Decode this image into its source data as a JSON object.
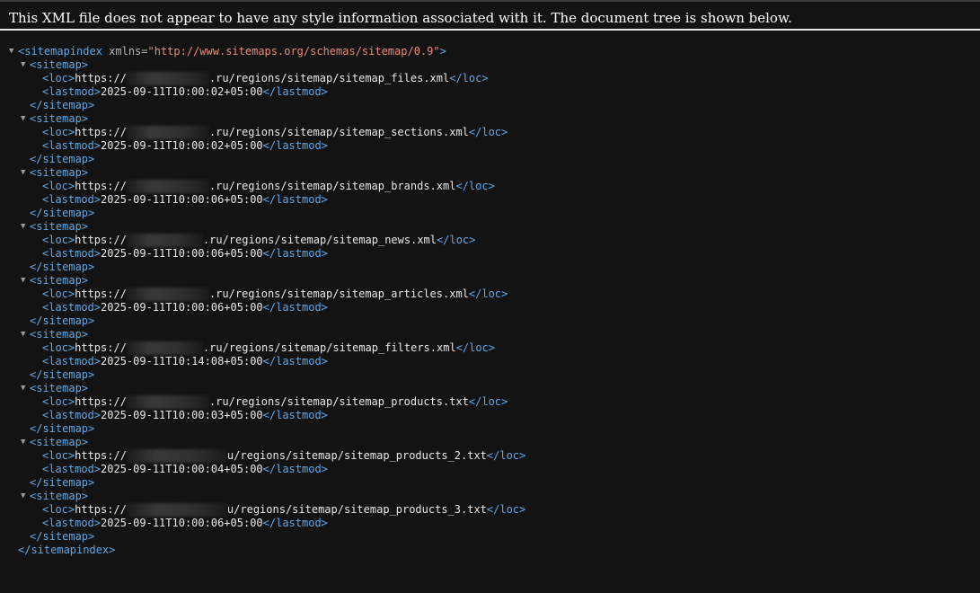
{
  "header": {
    "message": "This XML file does not appear to have any style information associated with it. The document tree is shown below."
  },
  "colors": {
    "background": "#131313",
    "tag": "#5fa8e8",
    "attribute_value": "#e88c78",
    "text": "#e8e8e8"
  },
  "root": {
    "open_tag": "<sitemapindex",
    "attr_name": " xmlns=",
    "attr_value": "\"http://www.sitemaps.org/schemas/sitemap/0.9\"",
    "open_tag_end": ">",
    "close_tag": "</sitemapindex>"
  },
  "tags": {
    "sitemap_open": "<sitemap>",
    "sitemap_close": "</sitemap>",
    "loc_open": "<loc>",
    "loc_close": "</loc>",
    "lastmod_open": "<lastmod>",
    "lastmod_close": "</lastmod>"
  },
  "sitemaps": [
    {
      "loc_prefix": "https://",
      "loc_suffix": ".ru/regions/sitemap/sitemap_files.xml",
      "lastmod": "2025-09-11T10:00:02+05:00"
    },
    {
      "loc_prefix": "https://",
      "loc_suffix": ".ru/regions/sitemap/sitemap_sections.xml",
      "lastmod": "2025-09-11T10:00:02+05:00"
    },
    {
      "loc_prefix": "https://",
      "loc_suffix": ".ru/regions/sitemap/sitemap_brands.xml",
      "lastmod": "2025-09-11T10:00:06+05:00"
    },
    {
      "loc_prefix": "https://",
      "loc_suffix": ".ru/regions/sitemap/sitemap_news.xml",
      "lastmod": "2025-09-11T10:00:06+05:00"
    },
    {
      "loc_prefix": "https://",
      "loc_suffix": ".ru/regions/sitemap/sitemap_articles.xml",
      "lastmod": "2025-09-11T10:00:06+05:00"
    },
    {
      "loc_prefix": "https://",
      "loc_suffix": ".ru/regions/sitemap/sitemap_filters.xml",
      "lastmod": "2025-09-11T10:14:08+05:00"
    },
    {
      "loc_prefix": "https://",
      "loc_suffix": ".ru/regions/sitemap/sitemap_products.txt",
      "lastmod": "2025-09-11T10:00:03+05:00"
    },
    {
      "loc_prefix": "https://",
      "loc_suffix": "u/regions/sitemap/sitemap_products_2.txt",
      "lastmod": "2025-09-11T10:00:04+05:00"
    },
    {
      "loc_prefix": "https://",
      "loc_suffix": "u/regions/sitemap/sitemap_products_3.txt",
      "lastmod": "2025-09-11T10:00:06+05:00"
    }
  ]
}
